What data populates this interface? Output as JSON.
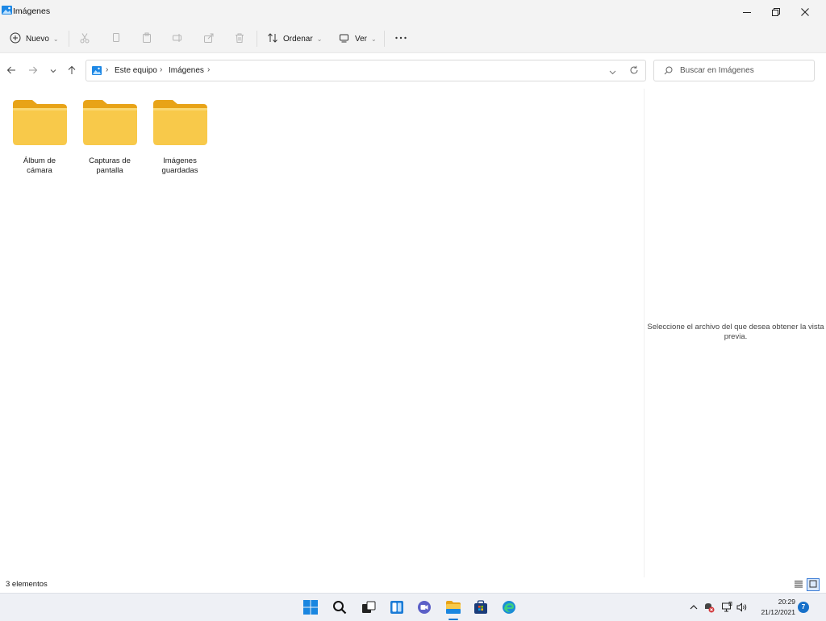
{
  "window": {
    "title": "Imágenes",
    "minimize_icon": "minimize-icon",
    "restore_icon": "restore-icon",
    "close_icon": "close-icon"
  },
  "commandbar": {
    "new_label": "Nuevo",
    "sort_label": "Ordenar",
    "view_label": "Ver",
    "icons": [
      "add-icon",
      "cut-icon",
      "copy-icon",
      "paste-icon",
      "rename-icon",
      "share-icon",
      "delete-icon",
      "sort-icon",
      "view-icon",
      "more-icon"
    ]
  },
  "navigation": {
    "breadcrumb": [
      "Este equipo",
      "Imágenes"
    ],
    "search_placeholder": "Buscar en Imágenes"
  },
  "folders": [
    {
      "line1": "Álbum de",
      "line2": "cámara"
    },
    {
      "line1": "Capturas de",
      "line2": "pantalla"
    },
    {
      "line1": "Imágenes",
      "line2": "guardadas"
    }
  ],
  "preview": {
    "message_line1": "Seleccione el archivo del que desea obtener la vista",
    "message_line2": "previa."
  },
  "statusbar": {
    "item_count": "3 elementos"
  },
  "taskbar": {
    "time": "20:29",
    "date": "21/12/2021",
    "notification_count": "7",
    "apps": [
      "windows-start-icon",
      "search-icon",
      "task-view-icon",
      "widgets-icon",
      "chat-icon",
      "file-explorer-icon",
      "microsoft-store-icon",
      "edge-icon"
    ]
  },
  "colors": {
    "folder_yellow": "#f8c94a",
    "accent_blue": "#1877d2",
    "chrome_bg": "#f3f3f3"
  }
}
